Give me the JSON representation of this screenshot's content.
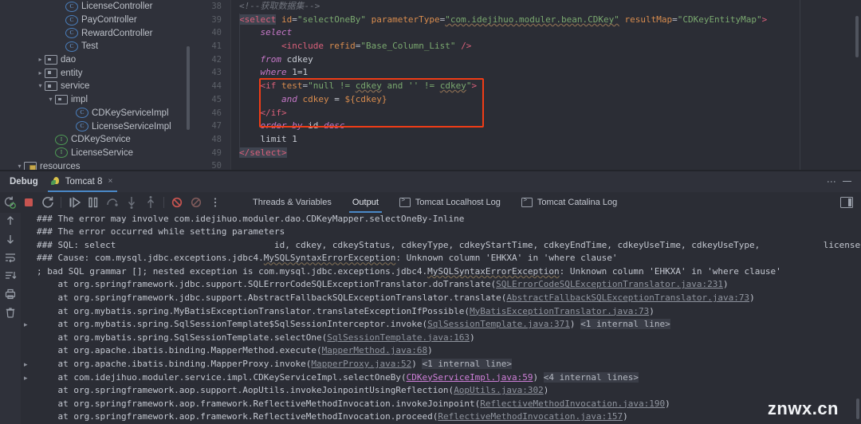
{
  "project_tree": {
    "items": [
      {
        "label": "LicenseController",
        "icon": "class-icon",
        "indent": 5,
        "arrow": "",
        "type": "class"
      },
      {
        "label": "PayController",
        "icon": "class-icon",
        "indent": 5,
        "arrow": "",
        "type": "class"
      },
      {
        "label": "RewardController",
        "icon": "class-icon",
        "indent": 5,
        "arrow": "",
        "type": "class"
      },
      {
        "label": "Test",
        "icon": "class-icon",
        "indent": 5,
        "arrow": "",
        "type": "class"
      },
      {
        "label": "dao",
        "icon": "package-icon",
        "indent": 3,
        "arrow": "collapsed",
        "type": "package"
      },
      {
        "label": "entity",
        "icon": "package-icon",
        "indent": 3,
        "arrow": "collapsed",
        "type": "package"
      },
      {
        "label": "service",
        "icon": "package-icon",
        "indent": 3,
        "arrow": "expanded",
        "type": "package"
      },
      {
        "label": "impl",
        "icon": "package-icon",
        "indent": 4,
        "arrow": "expanded",
        "type": "package"
      },
      {
        "label": "CDKeyServiceImpl",
        "icon": "class-icon",
        "indent": 6,
        "arrow": "",
        "type": "class"
      },
      {
        "label": "LicenseServiceImpl",
        "icon": "class-icon",
        "indent": 6,
        "arrow": "",
        "type": "class"
      },
      {
        "label": "CDKeyService",
        "icon": "interface-icon",
        "indent": 4,
        "arrow": "",
        "type": "interface"
      },
      {
        "label": "LicenseService",
        "icon": "interface-icon",
        "indent": 4,
        "arrow": "",
        "type": "interface"
      },
      {
        "label": "resources",
        "icon": "resources-folder-icon",
        "indent": 1,
        "arrow": "expanded",
        "type": "resources"
      }
    ],
    "class_icon_letter": "C",
    "interface_icon_letter": "I"
  },
  "editor": {
    "line_numbers": [
      "38",
      "39",
      "40",
      "41",
      "42",
      "43",
      "44",
      "45",
      "46",
      "47",
      "48",
      "49",
      "50"
    ],
    "lines": [
      {
        "n": "38",
        "text": "<!--获取数据集-->"
      },
      {
        "n": "39",
        "text": "<select id=\"selectOneBy\" parameterType=\"com.idejihuo.moduler.bean.CDKey\" resultMap=\"CDKeyEntityMap\">"
      },
      {
        "n": "40",
        "text": "    select"
      },
      {
        "n": "41",
        "text": "        <include refid=\"Base_Column_List\" />"
      },
      {
        "n": "42",
        "text": "    from cdkey"
      },
      {
        "n": "43",
        "text": "    where 1=1"
      },
      {
        "n": "44",
        "text": "    <if test=\"null != cdkey and '' != cdkey\">"
      },
      {
        "n": "45",
        "text": "        and cdkey = ${cdkey}"
      },
      {
        "n": "46",
        "text": "    </if>"
      },
      {
        "n": "47",
        "text": "    order by id desc"
      },
      {
        "n": "48",
        "text": "    limit 1"
      },
      {
        "n": "49",
        "text": "</select>"
      },
      {
        "n": "50",
        "text": ""
      }
    ],
    "highlight_annotation": "red-rectangle-around-if-block"
  },
  "debug_panel": {
    "title": "Debug",
    "run_tab": {
      "label": "Tomcat 8",
      "close": "×"
    },
    "header_icons": {
      "more": "⋮",
      "minimize": "minimize-icon"
    },
    "toolbar_tabs": [
      {
        "label": "Threads & Variables",
        "selected": false,
        "icon": ""
      },
      {
        "label": "Output",
        "selected": true,
        "icon": ""
      },
      {
        "label": "Tomcat Localhost Log",
        "selected": false,
        "icon": "log-icon"
      },
      {
        "label": "Tomcat Catalina Log",
        "selected": false,
        "icon": "log-icon"
      }
    ],
    "toolbar_buttons": [
      {
        "name": "rerun-button"
      },
      {
        "name": "stop-button"
      },
      {
        "name": "restart-button"
      },
      {
        "name": "resume-button"
      },
      {
        "name": "pause-button"
      },
      {
        "name": "step-over-button"
      },
      {
        "name": "step-into-button"
      },
      {
        "name": "step-out-button"
      },
      {
        "name": "mute-breakpoints-button"
      },
      {
        "name": "view-breakpoints-button"
      },
      {
        "name": "more-options-button"
      }
    ],
    "side_rail_buttons": [
      {
        "name": "scroll-up-button",
        "glyph": "↑"
      },
      {
        "name": "scroll-down-button",
        "glyph": "↓"
      },
      {
        "name": "soft-wrap-button",
        "glyph": "↵"
      },
      {
        "name": "scroll-to-end-button",
        "glyph": "↧"
      },
      {
        "name": "print-button",
        "glyph": "⎙"
      },
      {
        "name": "clear-all-button",
        "glyph": "Ὕ1"
      }
    ]
  },
  "console": {
    "lines": [
      {
        "i": 0,
        "fold": "",
        "parts": [
          {
            "t": "### The error may involve com.idejihuo.moduler.dao.CDKeyMapper.selectOneBy-Inline",
            "s": "plain"
          }
        ]
      },
      {
        "i": 1,
        "fold": "",
        "parts": [
          {
            "t": "### The error occurred while setting parameters",
            "s": "plain"
          }
        ]
      },
      {
        "i": 2,
        "fold": "",
        "parts": [
          {
            "t": "### SQL: select                              id, cdkey, cdkeyStatus, cdkeyType, cdkeyStartTime, cdkeyEndTime, cdkeyUseTime, cdkeyUseType,            licenseCode, cdkeyUseStartTime, cdkey",
            "s": "plain"
          }
        ]
      },
      {
        "i": 3,
        "fold": "",
        "parts": [
          {
            "t": "### Cause: com.mysql.jdbc.exceptions.jdbc4.",
            "s": "plain"
          },
          {
            "t": "MySQLSyntaxErrorException",
            "s": "err"
          },
          {
            "t": ": Unknown column 'EHKXA' in 'where clause'",
            "s": "plain"
          }
        ]
      },
      {
        "i": 4,
        "fold": "",
        "parts": [
          {
            "t": "; bad SQL grammar []; nested exception is com.mysql.jdbc.exceptions.jdbc4.",
            "s": "plain"
          },
          {
            "t": "MySQLSyntaxErrorException",
            "s": "err"
          },
          {
            "t": ": Unknown column 'EHKXA' in 'where clause'",
            "s": "plain"
          }
        ]
      },
      {
        "i": 5,
        "fold": "",
        "parts": [
          {
            "t": "    at org.springframework.jdbc.support.SQLErrorCodeSQLExceptionTranslator.doTranslate(",
            "s": "plain"
          },
          {
            "t": "SQLErrorCodeSQLExceptionTranslator.java:231",
            "s": "link"
          },
          {
            "t": ")",
            "s": "plain"
          }
        ]
      },
      {
        "i": 6,
        "fold": "",
        "parts": [
          {
            "t": "    at org.springframework.jdbc.support.AbstractFallbackSQLExceptionTranslator.translate(",
            "s": "plain"
          },
          {
            "t": "AbstractFallbackSQLExceptionTranslator.java:73",
            "s": "link"
          },
          {
            "t": ")",
            "s": "plain"
          }
        ]
      },
      {
        "i": 7,
        "fold": "",
        "parts": [
          {
            "t": "    at org.mybatis.spring.MyBatisExceptionTranslator.translateExceptionIfPossible(",
            "s": "plain"
          },
          {
            "t": "MyBatisExceptionTranslator.java:73",
            "s": "link"
          },
          {
            "t": ")",
            "s": "plain"
          }
        ]
      },
      {
        "i": 8,
        "fold": ">",
        "parts": [
          {
            "t": "    at org.mybatis.spring.SqlSessionTemplate$SqlSessionInterceptor.invoke(",
            "s": "plain"
          },
          {
            "t": "SqlSessionTemplate.java:371",
            "s": "link"
          },
          {
            "t": ") ",
            "s": "plain"
          },
          {
            "t": "<1 internal line>",
            "s": "internal"
          }
        ]
      },
      {
        "i": 9,
        "fold": "",
        "parts": [
          {
            "t": "    at org.mybatis.spring.SqlSessionTemplate.selectOne(",
            "s": "plain"
          },
          {
            "t": "SqlSessionTemplate.java:163",
            "s": "link"
          },
          {
            "t": ")",
            "s": "plain"
          }
        ]
      },
      {
        "i": 10,
        "fold": "",
        "parts": [
          {
            "t": "    at org.apache.ibatis.binding.MapperMethod.execute(",
            "s": "plain"
          },
          {
            "t": "MapperMethod.java:68",
            "s": "link"
          },
          {
            "t": ")",
            "s": "plain"
          }
        ]
      },
      {
        "i": 11,
        "fold": ">",
        "parts": [
          {
            "t": "    at org.apache.ibatis.binding.MapperProxy.invoke(",
            "s": "plain"
          },
          {
            "t": "MapperProxy.java:52",
            "s": "link"
          },
          {
            "t": ") ",
            "s": "plain"
          },
          {
            "t": "<1 internal line>",
            "s": "internal"
          }
        ]
      },
      {
        "i": 12,
        "fold": ">",
        "parts": [
          {
            "t": "    at com.idejihuo.moduler.service.impl.CDKeyServiceImpl.selectOneBy(",
            "s": "plain"
          },
          {
            "t": "CDKeyServiceImpl.java:59",
            "s": "linkact"
          },
          {
            "t": ") ",
            "s": "plain"
          },
          {
            "t": "<4 internal lines>",
            "s": "internal"
          }
        ]
      },
      {
        "i": 13,
        "fold": "",
        "parts": [
          {
            "t": "    at org.springframework.aop.support.AopUtils.invokeJoinpointUsingReflection(",
            "s": "plain"
          },
          {
            "t": "AopUtils.java:302",
            "s": "link"
          },
          {
            "t": ")",
            "s": "plain"
          }
        ]
      },
      {
        "i": 14,
        "fold": "",
        "parts": [
          {
            "t": "    at org.springframework.aop.framework.ReflectiveMethodInvocation.invokeJoinpoint(",
            "s": "plain"
          },
          {
            "t": "ReflectiveMethodInvocation.java:190",
            "s": "link"
          },
          {
            "t": ")",
            "s": "plain"
          }
        ]
      },
      {
        "i": 15,
        "fold": "",
        "parts": [
          {
            "t": "    at org.springframework.aop.framework.ReflectiveMethodInvocation.proceed(",
            "s": "plain"
          },
          {
            "t": "ReflectiveMethodInvocation.java:157",
            "s": "link"
          },
          {
            "t": ")",
            "s": "plain"
          }
        ]
      }
    ]
  },
  "watermark": {
    "text": "znwx.cn"
  },
  "colors": {
    "bg": "#2b2d35",
    "panel_bg": "#2f313a",
    "accent_blue": "#4a88c7",
    "highlight_red": "#f03c16",
    "tag": "#d9607a",
    "attr": "#d88c4e",
    "string": "#7aa86f",
    "keyword": "#c678c8",
    "link": "#8f949e",
    "link_active": "#cf7fd8"
  }
}
